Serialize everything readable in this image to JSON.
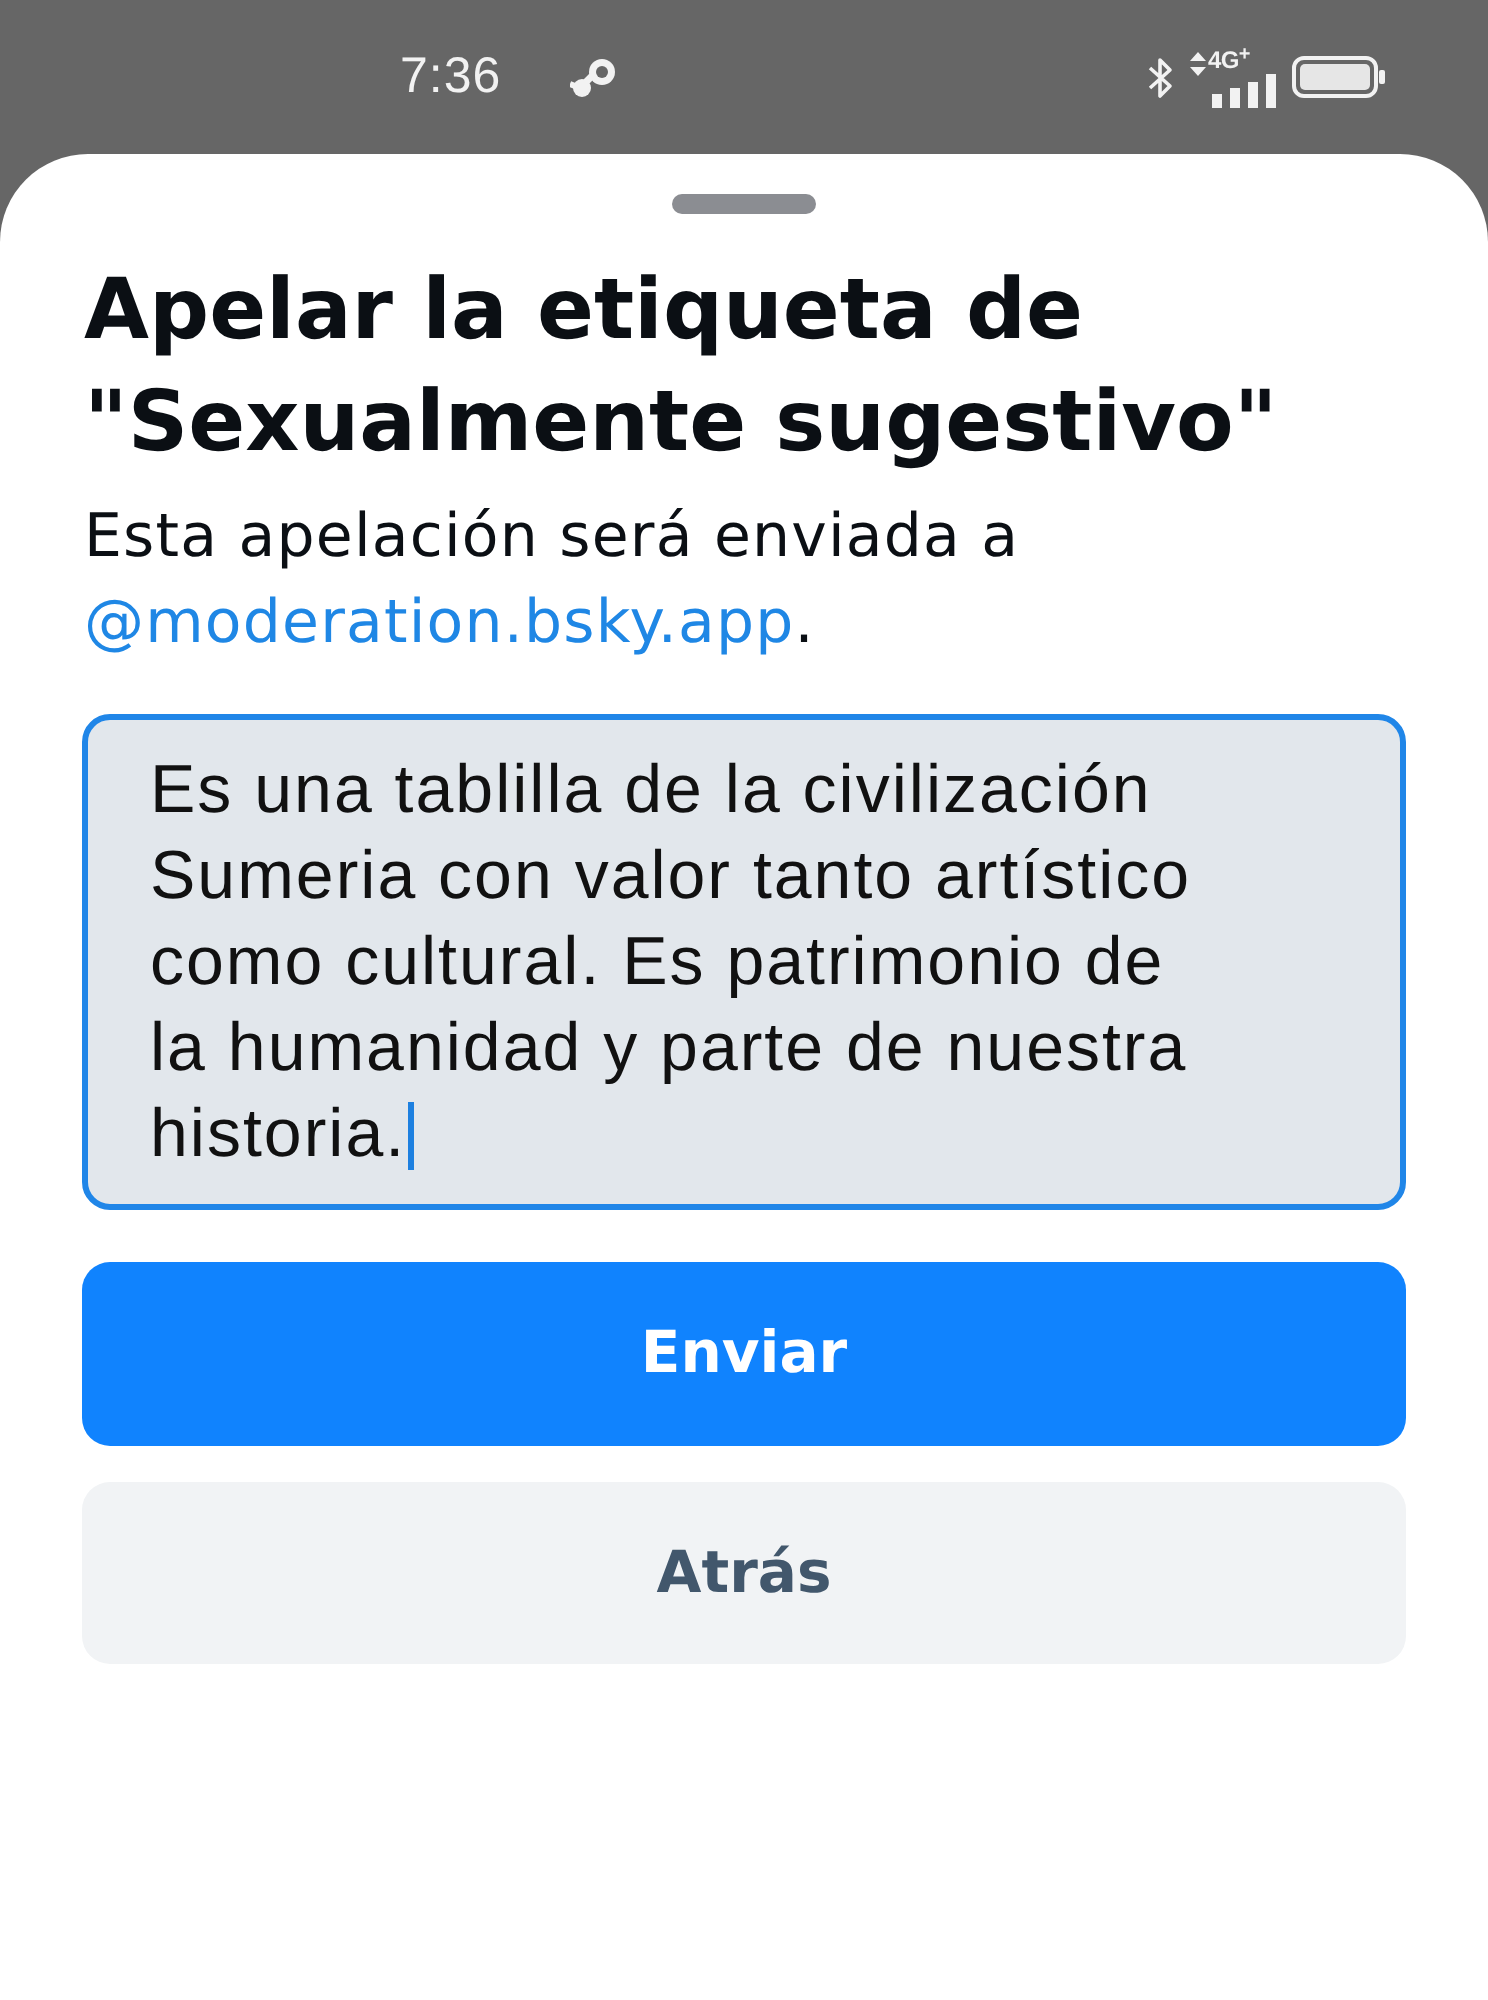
{
  "status_bar": {
    "time": "7:36",
    "network": "4G$^{+}$"
  },
  "sheet": {
    "title": "Apelar la etiqueta de \"Sexualmente sugestivo\"",
    "description": {
      "text": "Esta apelación será enviada a ",
      "link": "@moderation.bsky.app",
      "after_link": "."
    },
    "appeal_field": {
      "value": "Es una tablilla de la civilización Sumeria con valor tanto artístico como cultural. Es patrimonio de la humanidad y parte de nuestra historia.",
      "focused": true
    },
    "buttons": [
      {
        "label": "Enviar",
        "kind": "primary"
      },
      {
        "label": "Atrás",
        "kind": "secondary"
      }
    ]
  }
}
